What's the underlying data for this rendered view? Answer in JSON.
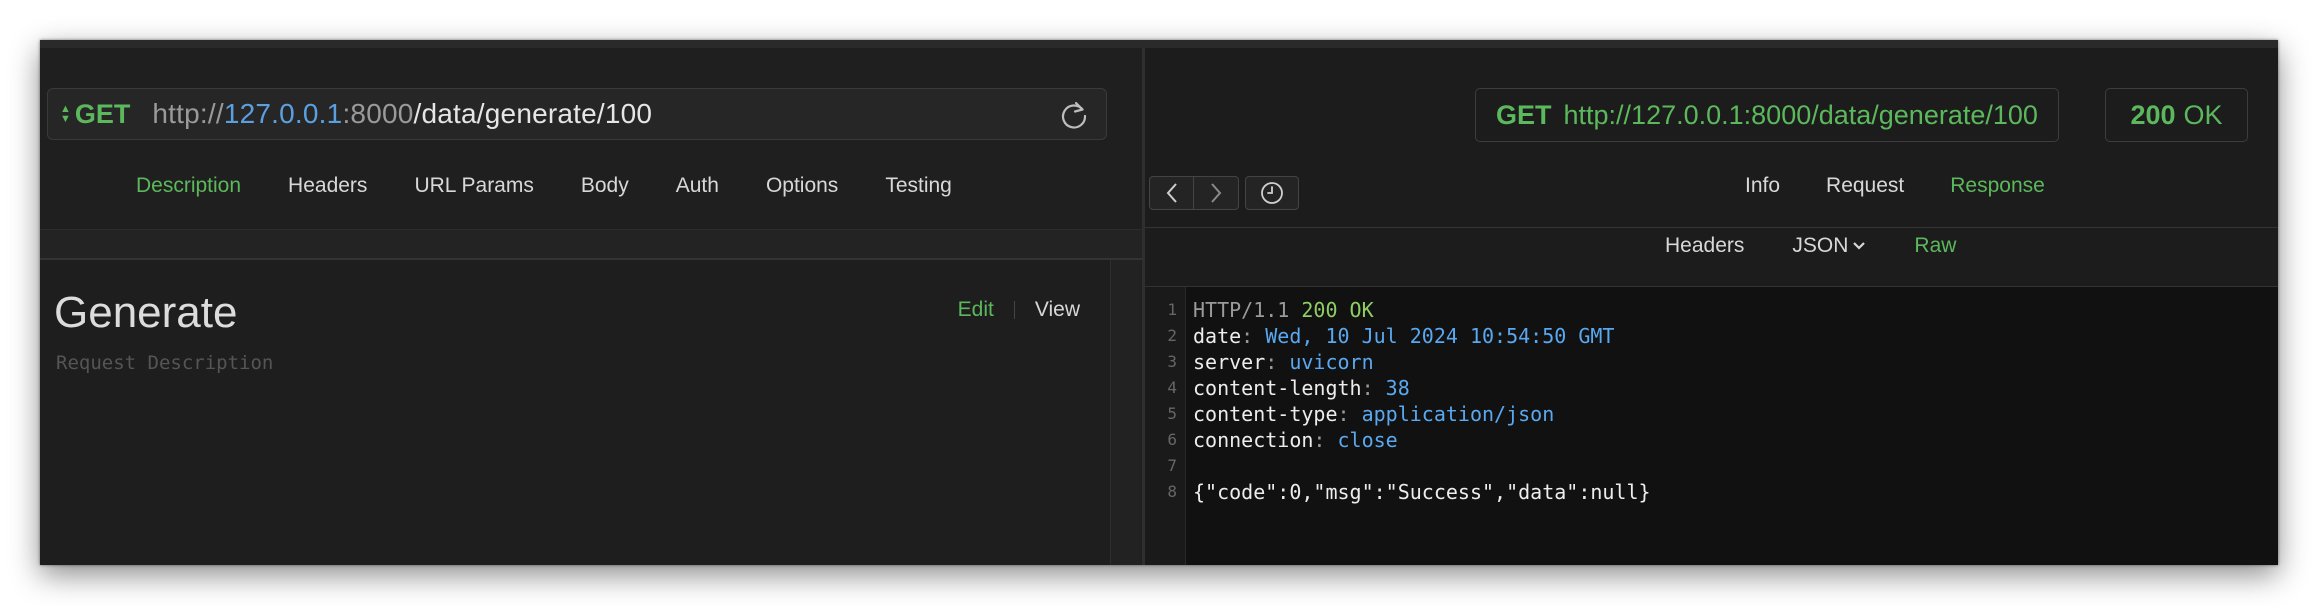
{
  "request": {
    "method": "GET",
    "url_scheme": "http://",
    "url_host": "127.0.0.1",
    "url_port": ":8000",
    "url_path": "/data/generate/100",
    "tabs": [
      "Description",
      "Headers",
      "URL Params",
      "Body",
      "Auth",
      "Options",
      "Testing"
    ],
    "active_tab": "Description"
  },
  "description": {
    "title": "Generate",
    "placeholder": "Request Description",
    "edit_label": "Edit",
    "view_label": "View"
  },
  "response": {
    "method": "GET",
    "url": "http://127.0.0.1:8000/data/generate/100",
    "status_code": "200",
    "status_text": "OK",
    "tabs": [
      "Info",
      "Request",
      "Response"
    ],
    "active_tab": "Response",
    "format_tabs": [
      "Headers",
      "JSON",
      "Raw"
    ],
    "active_format": "Raw",
    "lines": [
      {
        "num": "1",
        "parts": [
          {
            "t": "HTTP/1.1 ",
            "c": "gray"
          },
          {
            "t": "200 OK",
            "c": "green"
          }
        ]
      },
      {
        "num": "2",
        "parts": [
          {
            "t": "date",
            "c": "white"
          },
          {
            "t": ": ",
            "c": "gray"
          },
          {
            "t": "Wed, 10 Jul 2024 10:54:50 GMT",
            "c": "blue"
          }
        ]
      },
      {
        "num": "3",
        "parts": [
          {
            "t": "server",
            "c": "white"
          },
          {
            "t": ": ",
            "c": "gray"
          },
          {
            "t": "uvicorn",
            "c": "blue"
          }
        ]
      },
      {
        "num": "4",
        "parts": [
          {
            "t": "content-length",
            "c": "white"
          },
          {
            "t": ": ",
            "c": "gray"
          },
          {
            "t": "38",
            "c": "blue"
          }
        ]
      },
      {
        "num": "5",
        "parts": [
          {
            "t": "content-type",
            "c": "white"
          },
          {
            "t": ": ",
            "c": "gray"
          },
          {
            "t": "application/json",
            "c": "blue"
          }
        ]
      },
      {
        "num": "6",
        "parts": [
          {
            "t": "connection",
            "c": "white"
          },
          {
            "t": ": ",
            "c": "gray"
          },
          {
            "t": "close",
            "c": "blue"
          }
        ]
      },
      {
        "num": "7",
        "parts": []
      },
      {
        "num": "8",
        "parts": [
          {
            "t": "{\"code\":0,\"msg\":\"Success\",\"data\":null}",
            "c": "white"
          }
        ]
      }
    ]
  },
  "colors": {
    "accent_green": "#5cb85c",
    "value_blue": "#5aa8f0",
    "background": "#1e1e1e"
  },
  "icons": [
    "sort-arrows-icon",
    "reload-icon",
    "chevron-left-icon",
    "chevron-right-icon",
    "history-clock-icon",
    "chevron-down-icon"
  ]
}
